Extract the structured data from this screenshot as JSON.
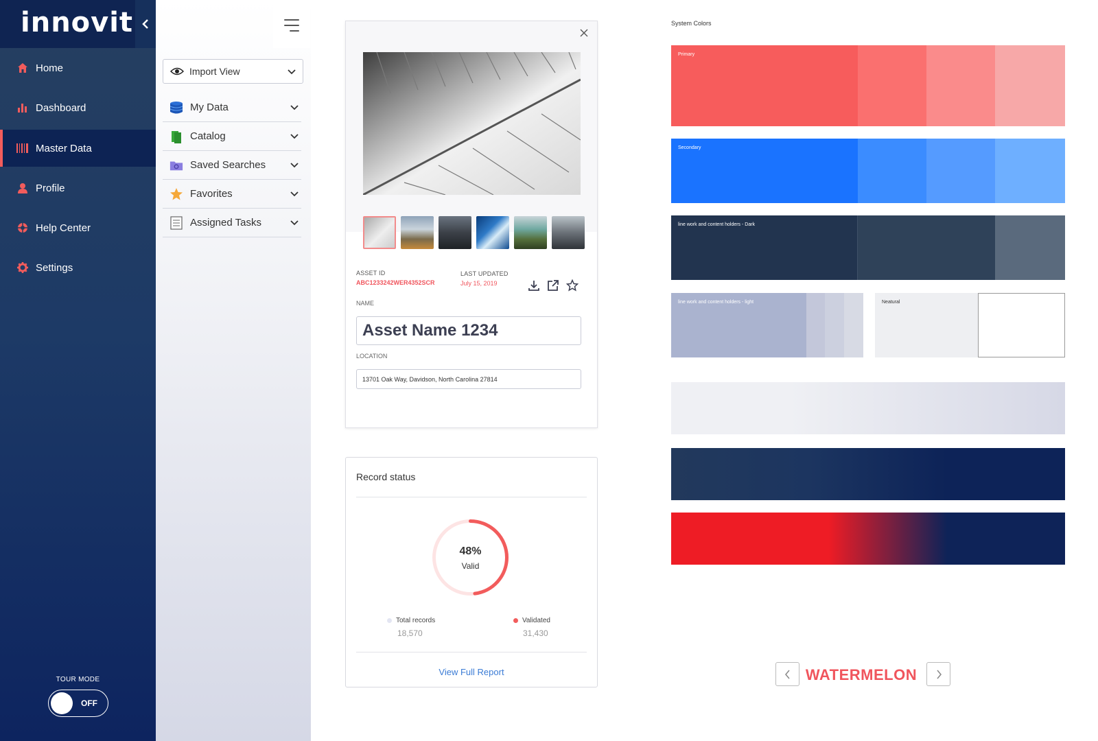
{
  "app": {
    "logo_text": "innovit"
  },
  "sidebar": {
    "items": [
      {
        "label": "Home",
        "icon": "home-icon"
      },
      {
        "label": "Dashboard",
        "icon": "bar-chart-icon"
      },
      {
        "label": "Master Data",
        "icon": "barcode-icon",
        "active": true
      },
      {
        "label": "Profile",
        "icon": "user-icon"
      },
      {
        "label": "Help Center",
        "icon": "lifebuoy-icon"
      },
      {
        "label": "Settings",
        "icon": "gear-icon"
      }
    ],
    "tour_mode_label": "TOUR MODE",
    "tour_toggle_state": "OFF",
    "accent_color": "#f25c5c"
  },
  "panel": {
    "view_select": "Import View",
    "menu": [
      {
        "label": "My Data",
        "icon": "database-icon"
      },
      {
        "label": "Catalog",
        "icon": "catalog-icon"
      },
      {
        "label": "Saved Searches",
        "icon": "folder-search-icon"
      },
      {
        "label": "Favorites",
        "icon": "star-icon"
      },
      {
        "label": "Assigned Tasks",
        "icon": "task-list-icon"
      }
    ]
  },
  "asset": {
    "asset_id_label": "ASSET ID",
    "asset_id": "ABC1233242WER4352SCR",
    "last_updated_label": "LAST UPDATED",
    "last_updated": "July 15, 2019",
    "name_label": "NAME",
    "name": "Asset Name 1234",
    "location_label": "LOCATION",
    "location": "13701 Oak Way, Davidson, North Carolina 27814",
    "thumbnails": 6
  },
  "record_status": {
    "title": "Record status",
    "percent": "48%",
    "percent_value": 0.48,
    "status": "Valid",
    "total_label": "Total records",
    "total_value": "18,570",
    "validated_label": "Validated",
    "validated_value": "31,430",
    "link": "View Full Report"
  },
  "colors": {
    "title": "System Colors",
    "primary_label": "Primary",
    "primary": [
      "#f75c5c",
      "#fa706f",
      "#fa8b8b",
      "#f7a8a8"
    ],
    "secondary_label": "Secondary",
    "secondary": [
      "#1a73ff",
      "#3b8cff",
      "#559bff",
      "#6eafff"
    ],
    "dark_label": "line work and content holders - Dark",
    "dark": [
      "#22344f",
      "#2f4259",
      "#5a6a7d"
    ],
    "light_label": "line work and content holders - light",
    "light": [
      "#aab3cf",
      "#c3c7da",
      "#ccd0df",
      "#d7dae4"
    ],
    "neutral_label": "Neatural",
    "neutral": [
      "#eeeff2",
      "#ffffff"
    ],
    "current_name": "WATERMELON"
  }
}
